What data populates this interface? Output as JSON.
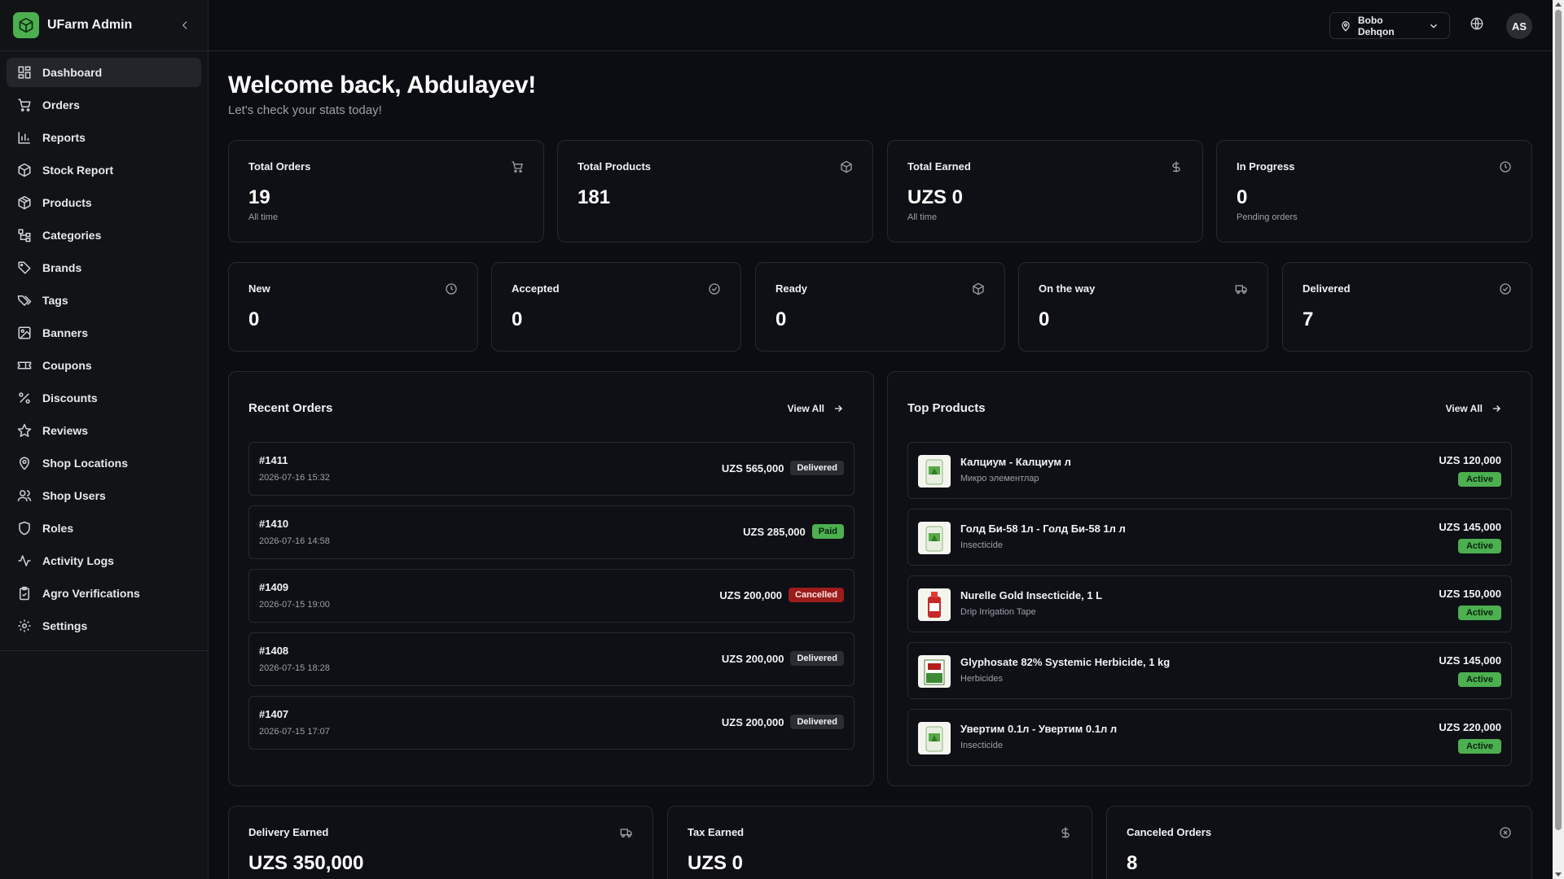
{
  "app": {
    "title": "UFarm Admin"
  },
  "sidebar": {
    "items": [
      {
        "label": "Dashboard",
        "icon": "dashboard-icon",
        "active": true
      },
      {
        "label": "Orders",
        "icon": "cart-icon"
      },
      {
        "label": "Reports",
        "icon": "bar-chart-icon"
      },
      {
        "label": "Stock Report",
        "icon": "box-icon"
      },
      {
        "label": "Products",
        "icon": "package-icon"
      },
      {
        "label": "Categories",
        "icon": "categories-icon"
      },
      {
        "label": "Brands",
        "icon": "tag-icon"
      },
      {
        "label": "Tags",
        "icon": "tags-icon"
      },
      {
        "label": "Banners",
        "icon": "image-icon"
      },
      {
        "label": "Coupons",
        "icon": "ticket-icon"
      },
      {
        "label": "Discounts",
        "icon": "percent-icon"
      },
      {
        "label": "Reviews",
        "icon": "star-icon"
      },
      {
        "label": "Shop Locations",
        "icon": "map-pin-icon"
      },
      {
        "label": "Shop Users",
        "icon": "users-icon"
      },
      {
        "label": "Roles",
        "icon": "shield-icon"
      },
      {
        "label": "Activity Logs",
        "icon": "activity-icon"
      },
      {
        "label": "Agro Verifications",
        "icon": "clipboard-check-icon"
      },
      {
        "label": "Settings",
        "icon": "gear-icon"
      }
    ]
  },
  "header": {
    "location": "Bobo Dehqon",
    "avatar_initials": "AS"
  },
  "welcome": {
    "title": "Welcome back, Abdulayev!",
    "subtitle": "Let's check your stats today!"
  },
  "stats_top": [
    {
      "title": "Total Orders",
      "value": "19",
      "note": "All time",
      "icon": "cart-icon"
    },
    {
      "title": "Total Products",
      "value": "181",
      "note": "",
      "icon": "package-icon"
    },
    {
      "title": "Total Earned",
      "value": "UZS 0",
      "note": "All time",
      "icon": "dollar-icon"
    },
    {
      "title": "In Progress",
      "value": "0",
      "note": "Pending orders",
      "icon": "clock-icon"
    }
  ],
  "stats_status": [
    {
      "title": "New",
      "value": "0",
      "icon": "clock-icon"
    },
    {
      "title": "Accepted",
      "value": "0",
      "icon": "check-circle-icon"
    },
    {
      "title": "Ready",
      "value": "0",
      "icon": "package-icon"
    },
    {
      "title": "On the way",
      "value": "0",
      "icon": "truck-icon"
    },
    {
      "title": "Delivered",
      "value": "7",
      "icon": "check-circle-icon"
    }
  ],
  "recent_orders": {
    "title": "Recent Orders",
    "view_all": "View All",
    "rows": [
      {
        "id": "#1411",
        "date": "2026-07-16 15:32",
        "amount": "UZS 565,000",
        "status": "Delivered"
      },
      {
        "id": "#1410",
        "date": "2026-07-16 14:58",
        "amount": "UZS 285,000",
        "status": "Paid"
      },
      {
        "id": "#1409",
        "date": "2026-07-15 19:00",
        "amount": "UZS 200,000",
        "status": "Cancelled"
      },
      {
        "id": "#1408",
        "date": "2026-07-15 18:28",
        "amount": "UZS 200,000",
        "status": "Delivered"
      },
      {
        "id": "#1407",
        "date": "2026-07-15 17:07",
        "amount": "UZS 200,000",
        "status": "Delivered"
      }
    ]
  },
  "top_products": {
    "title": "Top Products",
    "view_all": "View All",
    "rows": [
      {
        "name": "Калциум - Калциум л",
        "category": "Микро элементлар",
        "price": "UZS 120,000",
        "status": "Active"
      },
      {
        "name": "Голд Би-58 1л - Голд Би-58 1л л",
        "category": "Insecticide",
        "price": "UZS 145,000",
        "status": "Active"
      },
      {
        "name": "Nurelle Gold Insecticide, 1 L",
        "category": "Drip Irrigation Tape",
        "price": "UZS 150,000",
        "status": "Active"
      },
      {
        "name": "Glyphosate 82% Systemic Herbicide, 1 kg",
        "category": "Herbicides",
        "price": "UZS 145,000",
        "status": "Active"
      },
      {
        "name": "Увертим 0.1л - Увертим 0.1л л",
        "category": "Insecticide",
        "price": "UZS 220,000",
        "status": "Active"
      }
    ]
  },
  "stats_bottom": [
    {
      "title": "Delivery Earned",
      "value": "UZS 350,000",
      "icon": "truck-icon"
    },
    {
      "title": "Tax Earned",
      "value": "UZS 0",
      "icon": "dollar-icon"
    },
    {
      "title": "Canceled Orders",
      "value": "8",
      "icon": "x-circle-icon"
    }
  ],
  "colors": {
    "background": "#0b0d12",
    "sidebar": "#121317",
    "accent_green": "#4caf50",
    "cancelled_red": "#9b1c1c"
  }
}
